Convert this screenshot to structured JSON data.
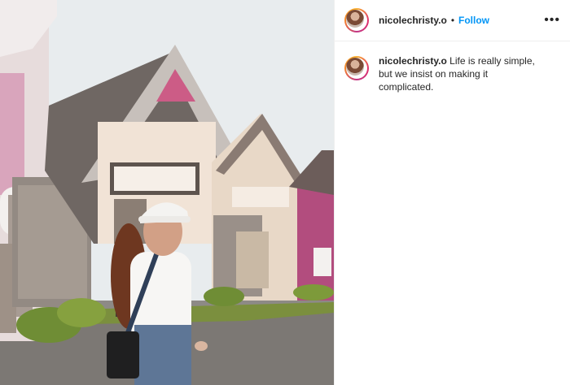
{
  "post": {
    "username": "nicolechristy.o",
    "separator": "•",
    "follow_label": "Follow",
    "more_icon": "•••",
    "caption_username": "nicolechristy.o",
    "caption_text": "Life is really simple, but we insist on making it complicated."
  },
  "icons": {
    "more": "more-options-icon",
    "avatar": "profile-avatar"
  },
  "colors": {
    "follow": "#0095f6",
    "text": "#262626",
    "divider": "#efefef"
  }
}
